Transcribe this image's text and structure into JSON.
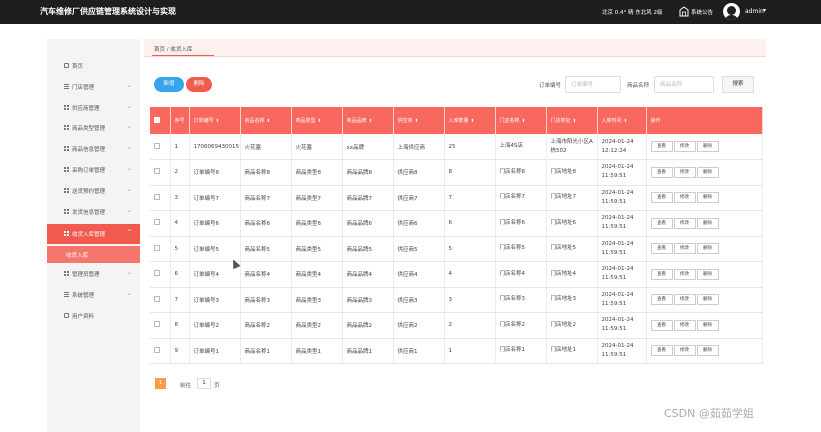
{
  "header": {
    "title": "汽车维修厂供应链管理系统设计与实现",
    "weather": "北京 0.4° 晴 东北风 2级",
    "notice_label": "系统公告",
    "user": "admin",
    "user_caret": "▾"
  },
  "sidebar": {
    "items": [
      {
        "label": "首页",
        "icon": "home-icon"
      },
      {
        "label": "门店管理",
        "icon": "lines-icon"
      },
      {
        "label": "供应商管理",
        "icon": "grid-icon"
      },
      {
        "label": "商品类型管理",
        "icon": "grid-icon"
      },
      {
        "label": "商品信息管理",
        "icon": "grid-icon"
      },
      {
        "label": "采购订单管理",
        "icon": "grid-icon"
      },
      {
        "label": "送货预约管理",
        "icon": "grid-icon"
      },
      {
        "label": "发货信息管理",
        "icon": "grid-icon"
      },
      {
        "label": "收货入库管理",
        "icon": "grid-icon"
      },
      {
        "label": "管理员管理",
        "icon": "grid-icon"
      },
      {
        "label": "系统管理",
        "icon": "lines-icon"
      },
      {
        "label": "用户资料",
        "icon": "user-icon"
      }
    ],
    "sub_item": "收货入库",
    "chevron": "⌄",
    "chevron_up": "^"
  },
  "breadcrumb": "首页 / 收货入库",
  "toolbar": {
    "add": "新增",
    "delete": "删除"
  },
  "search": {
    "order_label": "订单编号",
    "order_placeholder": "订单编号",
    "product_label": "商品名称",
    "product_placeholder": "商品名称",
    "button": "搜索"
  },
  "table": {
    "headers": [
      "",
      "序号",
      "订单编号",
      "商品名称",
      "商品类型",
      "商品品牌",
      "供应商",
      "入库数量",
      "门店名称",
      "门店地址",
      "入库时间",
      "操作"
    ],
    "sort_marker": "⬍",
    "ops": [
      "查看",
      "修改",
      "删除"
    ],
    "rows": [
      [
        "1",
        "1706069430015",
        "火花塞",
        "火花塞",
        "xx品牌",
        "上海供应商",
        "25",
        "上海4S店",
        "上海市阳光小区A栋502",
        "2024-01-24 12:12:24"
      ],
      [
        "2",
        "订单编号8",
        "商品名称8",
        "商品类型8",
        "商品品牌8",
        "供应商8",
        "8",
        "门店名称8",
        "门店地址8",
        "2024-01-24 11:59:51"
      ],
      [
        "3",
        "订单编号7",
        "商品名称7",
        "商品类型7",
        "商品品牌7",
        "供应商7",
        "7",
        "门店名称7",
        "门店地址7",
        "2024-01-24 11:59:51"
      ],
      [
        "4",
        "订单编号6",
        "商品名称6",
        "商品类型6",
        "商品品牌6",
        "供应商6",
        "6",
        "门店名称6",
        "门店地址6",
        "2024-01-24 11:59:51"
      ],
      [
        "5",
        "订单编号5",
        "商品名称5",
        "商品类型5",
        "商品品牌5",
        "供应商5",
        "5",
        "门店名称5",
        "门店地址5",
        "2024-01-24 11:59:51"
      ],
      [
        "6",
        "订单编号4",
        "商品名称4",
        "商品类型4",
        "商品品牌4",
        "供应商4",
        "4",
        "门店名称4",
        "门店地址4",
        "2024-01-24 11:59:51"
      ],
      [
        "7",
        "订单编号3",
        "商品名称3",
        "商品类型3",
        "商品品牌3",
        "供应商3",
        "3",
        "门店名称3",
        "门店地址3",
        "2024-01-24 11:59:51"
      ],
      [
        "8",
        "订单编号2",
        "商品名称2",
        "商品类型2",
        "商品品牌2",
        "供应商2",
        "2",
        "门店名称2",
        "门店地址2",
        "2024-01-24 11:59:51"
      ],
      [
        "9",
        "订单编号1",
        "商品名称1",
        "商品类型1",
        "商品品牌1",
        "供应商1",
        "1",
        "门店名称1",
        "门店地址1",
        "2024-01-24 11:59:51"
      ]
    ]
  },
  "pager": {
    "current": "1",
    "goto_label": "前往",
    "page_input": "1",
    "page_unit": "页"
  },
  "watermark": "CSDN @茹茹学姐",
  "colors": {
    "accent": "#f05a4f",
    "header_bg": "#f9685e",
    "add_button": "#37a4ec",
    "pager": "#f79d46",
    "topbar": "#1e1e1e"
  }
}
